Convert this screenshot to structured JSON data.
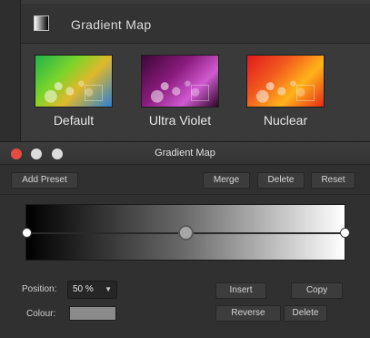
{
  "presets_panel": {
    "title": "Gradient Map",
    "icon": "gradient-icon",
    "presets": [
      {
        "label": "Default"
      },
      {
        "label": "Ultra Violet"
      },
      {
        "label": "Nuclear"
      }
    ]
  },
  "window": {
    "title": "Gradient Map",
    "traffic_light_colors": {
      "close": "#e74b41",
      "minimize": "#dcdcdc",
      "maximize": "#dcdcdc"
    }
  },
  "toolbar": {
    "add_preset": "Add Preset",
    "merge": "Merge",
    "delete": "Delete",
    "reset": "Reset"
  },
  "gradient": {
    "start_color": "#000000",
    "end_color": "#ffffff",
    "midpoint_percent": 50
  },
  "fields": {
    "position_label": "Position:",
    "position_value": "50 %",
    "colour_label": "Colour:",
    "colour_value": "#8a8a8a"
  },
  "actions": {
    "insert": "Insert",
    "copy": "Copy",
    "reverse": "Reverse",
    "delete": "Delete"
  }
}
